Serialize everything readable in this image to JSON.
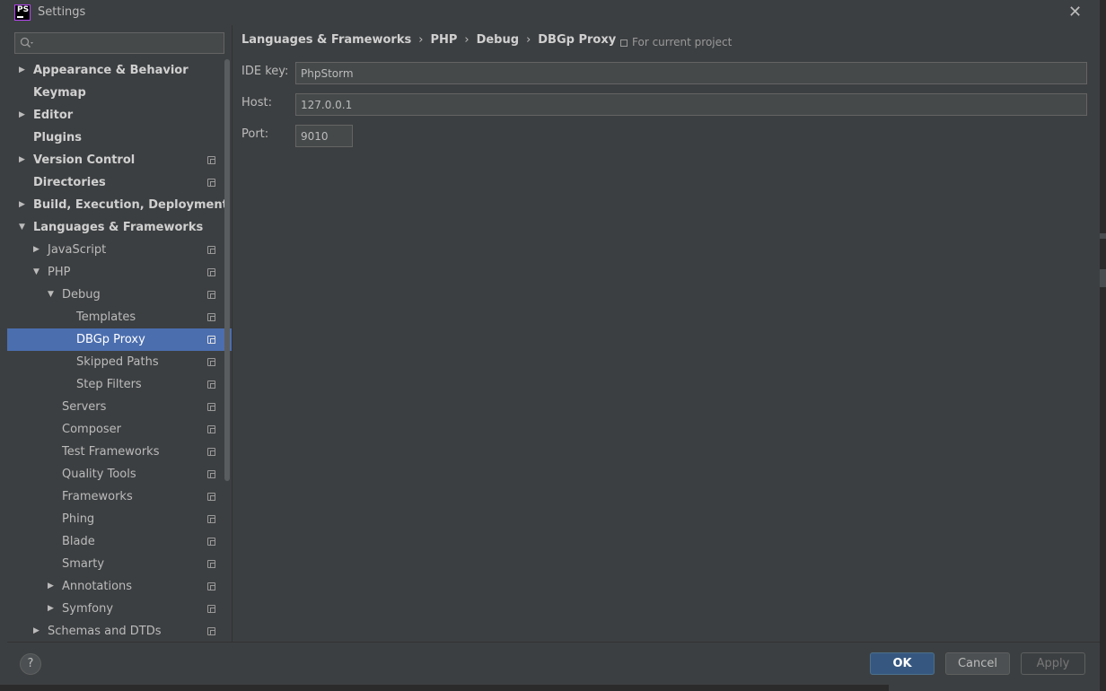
{
  "window": {
    "title": "Settings",
    "logo_text": "PS"
  },
  "search": {
    "placeholder": "",
    "value": ""
  },
  "tree": [
    {
      "label": "Appearance & Behavior",
      "level": 0,
      "expander": "collapsed",
      "bold": true,
      "project": false,
      "selected": false
    },
    {
      "label": "Keymap",
      "level": 0,
      "expander": "none",
      "bold": true,
      "project": false,
      "selected": false
    },
    {
      "label": "Editor",
      "level": 0,
      "expander": "collapsed",
      "bold": true,
      "project": false,
      "selected": false
    },
    {
      "label": "Plugins",
      "level": 0,
      "expander": "none",
      "bold": true,
      "project": false,
      "selected": false
    },
    {
      "label": "Version Control",
      "level": 0,
      "expander": "collapsed",
      "bold": true,
      "project": true,
      "selected": false
    },
    {
      "label": "Directories",
      "level": 0,
      "expander": "none",
      "bold": true,
      "project": true,
      "selected": false
    },
    {
      "label": "Build, Execution, Deployment",
      "level": 0,
      "expander": "collapsed",
      "bold": true,
      "project": false,
      "selected": false
    },
    {
      "label": "Languages & Frameworks",
      "level": 0,
      "expander": "expanded",
      "bold": true,
      "project": false,
      "selected": false
    },
    {
      "label": "JavaScript",
      "level": 1,
      "expander": "collapsed",
      "bold": false,
      "project": true,
      "selected": false
    },
    {
      "label": "PHP",
      "level": 1,
      "expander": "expanded",
      "bold": false,
      "project": true,
      "selected": false
    },
    {
      "label": "Debug",
      "level": 2,
      "expander": "expanded",
      "bold": false,
      "project": true,
      "selected": false
    },
    {
      "label": "Templates",
      "level": 3,
      "expander": "none",
      "bold": false,
      "project": true,
      "selected": false
    },
    {
      "label": "DBGp Proxy",
      "level": 3,
      "expander": "none",
      "bold": false,
      "project": true,
      "selected": true
    },
    {
      "label": "Skipped Paths",
      "level": 3,
      "expander": "none",
      "bold": false,
      "project": true,
      "selected": false
    },
    {
      "label": "Step Filters",
      "level": 3,
      "expander": "none",
      "bold": false,
      "project": true,
      "selected": false
    },
    {
      "label": "Servers",
      "level": 2,
      "expander": "none",
      "bold": false,
      "project": true,
      "selected": false
    },
    {
      "label": "Composer",
      "level": 2,
      "expander": "none",
      "bold": false,
      "project": true,
      "selected": false
    },
    {
      "label": "Test Frameworks",
      "level": 2,
      "expander": "none",
      "bold": false,
      "project": true,
      "selected": false
    },
    {
      "label": "Quality Tools",
      "level": 2,
      "expander": "none",
      "bold": false,
      "project": true,
      "selected": false
    },
    {
      "label": "Frameworks",
      "level": 2,
      "expander": "none",
      "bold": false,
      "project": true,
      "selected": false
    },
    {
      "label": "Phing",
      "level": 2,
      "expander": "none",
      "bold": false,
      "project": true,
      "selected": false
    },
    {
      "label": "Blade",
      "level": 2,
      "expander": "none",
      "bold": false,
      "project": true,
      "selected": false
    },
    {
      "label": "Smarty",
      "level": 2,
      "expander": "none",
      "bold": false,
      "project": true,
      "selected": false
    },
    {
      "label": "Annotations",
      "level": 2,
      "expander": "collapsed",
      "bold": false,
      "project": true,
      "selected": false
    },
    {
      "label": "Symfony",
      "level": 2,
      "expander": "collapsed",
      "bold": false,
      "project": true,
      "selected": false
    },
    {
      "label": "Schemas and DTDs",
      "level": 1,
      "expander": "collapsed",
      "bold": false,
      "project": true,
      "selected": false
    }
  ],
  "breadcrumb": [
    "Languages & Frameworks",
    "PHP",
    "Debug",
    "DBGp Proxy"
  ],
  "breadcrumb_separator": "›",
  "scope_note": "For current project",
  "form": {
    "ide_key": {
      "label": "IDE key:",
      "value": "PhpStorm"
    },
    "host": {
      "label": "Host:",
      "value": "127.0.0.1"
    },
    "port": {
      "label": "Port:",
      "value": "9010"
    }
  },
  "buttons": {
    "help": "?",
    "ok": "OK",
    "cancel": "Cancel",
    "apply": "Apply"
  },
  "colors": {
    "background": "#3c3f41",
    "selection": "#4b6eaf",
    "primary_button": "#365880",
    "text": "#bbbbbb"
  }
}
